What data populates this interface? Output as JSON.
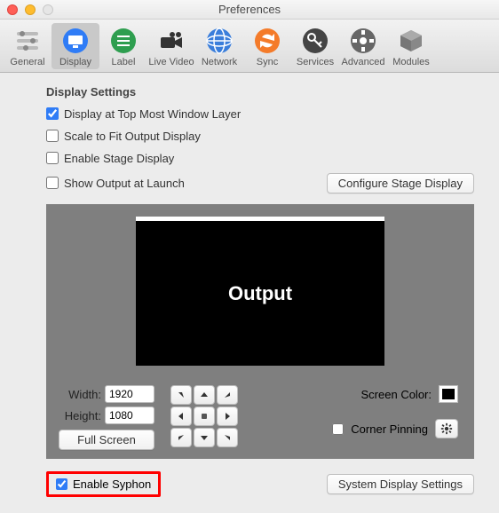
{
  "window": {
    "title": "Preferences"
  },
  "toolbar": {
    "items": [
      {
        "label": "General"
      },
      {
        "label": "Display"
      },
      {
        "label": "Label"
      },
      {
        "label": "Live Video"
      },
      {
        "label": "Network"
      },
      {
        "label": "Sync"
      },
      {
        "label": "Services"
      },
      {
        "label": "Advanced"
      },
      {
        "label": "Modules"
      }
    ]
  },
  "section": {
    "title": "Display Settings",
    "options": {
      "topMost": {
        "label": "Display at Top Most Window Layer",
        "checked": true
      },
      "scaleFit": {
        "label": "Scale to Fit Output Display",
        "checked": false
      },
      "stageDisplay": {
        "label": "Enable Stage Display",
        "checked": false
      },
      "showLaunch": {
        "label": "Show Output at Launch",
        "checked": false
      }
    },
    "configureStageBtn": "Configure Stage Display"
  },
  "preview": {
    "outputLabel": "Output",
    "widthLabel": "Width:",
    "widthValue": "1920",
    "heightLabel": "Height:",
    "heightValue": "1080",
    "fullScreenBtn": "Full Screen",
    "screenColorLabel": "Screen Color:",
    "screenColor": "#000000",
    "cornerPinning": {
      "label": "Corner Pinning",
      "checked": false
    }
  },
  "bottom": {
    "enableSyphon": {
      "label": "Enable Syphon",
      "checked": true
    },
    "systemSettingsBtn": "System Display Settings"
  }
}
